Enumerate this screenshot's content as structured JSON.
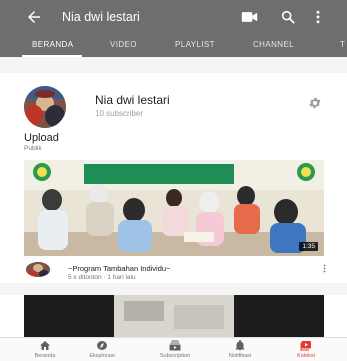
{
  "header": {
    "title": "Nia dwi lestari",
    "icons": [
      "back-arrow-icon",
      "video-camera-icon",
      "search-icon",
      "more-vert-icon"
    ]
  },
  "tabs": [
    {
      "label": "BERANDA",
      "active": true
    },
    {
      "label": "VIDEO",
      "active": false
    },
    {
      "label": "PLAYLIST",
      "active": false
    },
    {
      "label": "CHANNEL",
      "active": false
    },
    {
      "label": "T",
      "active": false
    }
  ],
  "channel": {
    "name": "Nia dwi lestari",
    "subscribers": "10 subscriber",
    "settings_icon": "gear-icon"
  },
  "section": {
    "title": "Upload",
    "visibility": "Publik"
  },
  "video": {
    "title": "~Program Tambahan Individu~",
    "meta": "5 x ditonton · 1 hari lalu",
    "duration": "1:35"
  },
  "bottom_nav": [
    {
      "label": "Beranda",
      "icon": "home-icon",
      "active": false
    },
    {
      "label": "Eksplorasi",
      "icon": "explore-icon",
      "active": false
    },
    {
      "label": "Subscription",
      "icon": "subscriptions-icon",
      "active": false
    },
    {
      "label": "Notifikasi",
      "icon": "bell-icon",
      "active": false
    },
    {
      "label": "Koleksi",
      "icon": "library-icon",
      "active": true
    }
  ],
  "colors": {
    "appbar": "#6e6e6e",
    "accent": "#e53935"
  }
}
